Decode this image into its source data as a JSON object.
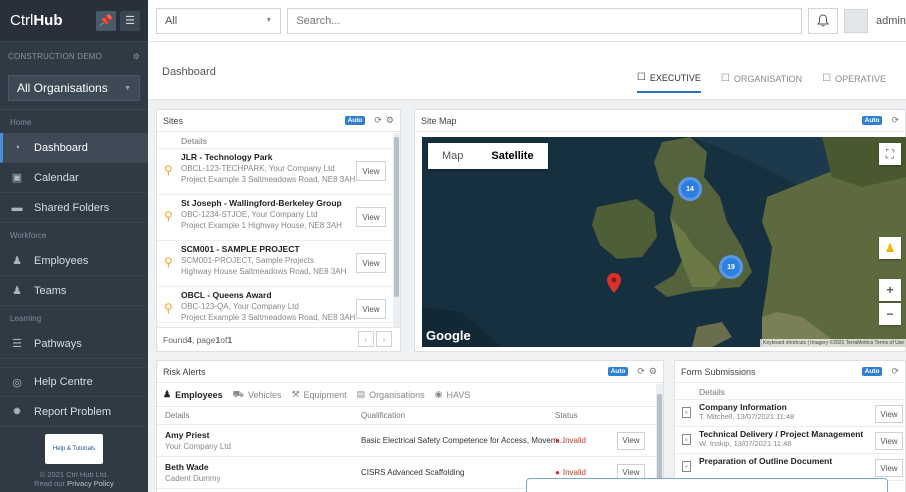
{
  "app": {
    "logo_prefix": "Ctrl",
    "logo_suffix": "Hub"
  },
  "sidebar": {
    "section_label": "CONSTRUCTION DEMO",
    "org_select": "All Organisations",
    "groups": [
      {
        "label": "Home",
        "items": [
          {
            "label": "Dashboard",
            "icon": "dashboard-icon",
            "active": true
          },
          {
            "label": "Calendar",
            "icon": "calendar-icon"
          },
          {
            "label": "Shared Folders",
            "icon": "folder-icon"
          }
        ]
      },
      {
        "label": "Workforce",
        "items": [
          {
            "label": "Employees",
            "icon": "user-icon"
          },
          {
            "label": "Teams",
            "icon": "team-icon"
          }
        ]
      },
      {
        "label": "Learning",
        "items": [
          {
            "label": "Pathways",
            "icon": "list-icon"
          }
        ]
      }
    ],
    "help": "Help Centre",
    "report": "Report Problem",
    "footer_logo_text": "Help & Tutorials",
    "copyright": "© 2021 Ctrl Hub Ltd.",
    "privacy_prefix": "Read our",
    "privacy_link": "Privacy Policy"
  },
  "topbar": {
    "scope": "All",
    "search_placeholder": "Search...",
    "username": "admin"
  },
  "dashboard": {
    "title": "Dashboard",
    "tabs": [
      "EXECUTIVE",
      "ORGANISATION",
      "OPERATIVE"
    ]
  },
  "sites": {
    "title": "Sites",
    "auto": "Auto",
    "col": "Details",
    "items": [
      {
        "title": "JLR - Technology Park",
        "line1": "OBCL-123-TECHPARK, Your Company Ltd",
        "line2": "Project Example 3 Saltmeadows Road, NE8 3AH"
      },
      {
        "title": "St Joseph - Wallingford-Berkeley Group",
        "line1": "OBC-1234-STJOE, Your Company Ltd",
        "line2": "Project Example 1 Highway House, NE8 3AH"
      },
      {
        "title": "SCM001 - SAMPLE PROJECT",
        "line1": "SCM001-PROJECT, Sample Projects",
        "line2": "Highway House Saltmeadows Road, NE8 3AH"
      },
      {
        "title": "OBCL - Queens Award",
        "line1": "OBC-123-QA, Your Company Ltd",
        "line2": "Project Example 3 Saltmeadows Road, NE8 3AH"
      }
    ],
    "view_label": "View",
    "found_prefix": "Found ",
    "found_count": "4",
    "found_mid": ", page ",
    "page": "1",
    "of": " of ",
    "pages": "1"
  },
  "sitemap": {
    "title": "Site Map",
    "auto": "Auto",
    "map_btn": "Map",
    "sat_btn": "Satellite",
    "clusters": [
      "14",
      "19"
    ],
    "google": "Google",
    "attribution": "Keyboard shortcuts  |  Imagery ©2021 TerraMetrics  Terms of Use"
  },
  "risk": {
    "title": "Risk Alerts",
    "auto": "Auto",
    "tabs": [
      {
        "label": "Employees",
        "icon": "user-icon"
      },
      {
        "label": "Vehicles",
        "icon": "car-icon"
      },
      {
        "label": "Equipment",
        "icon": "wrench-icon"
      },
      {
        "label": "Organisations",
        "icon": "building-icon"
      },
      {
        "label": "HAVS",
        "icon": "vibration-icon"
      }
    ],
    "headers": [
      "Details",
      "Qualification",
      "Status"
    ],
    "rows": [
      {
        "name": "Amy Priest",
        "org": "Your Company Ltd",
        "qual": "Basic Electrical Safety Competence for Access, Movem...",
        "status": "Invalid"
      },
      {
        "name": "Beth Wade",
        "org": "Cadent Dummy",
        "qual": "CISRS Advanced Scaffolding",
        "status": "Invalid"
      }
    ],
    "view_label": "View"
  },
  "forms": {
    "title": "Form Submissions",
    "auto": "Auto",
    "col": "Details",
    "items": [
      {
        "title": "Company Information",
        "sub": "T. Mitchell, 13/07/2021 11:48"
      },
      {
        "title": "Technical Delivery / Project Management",
        "sub": "W. Inskip, 13/07/2021 11:48"
      },
      {
        "title": "Preparation of Outline Document",
        "sub": ""
      }
    ],
    "view_label": "View"
  }
}
